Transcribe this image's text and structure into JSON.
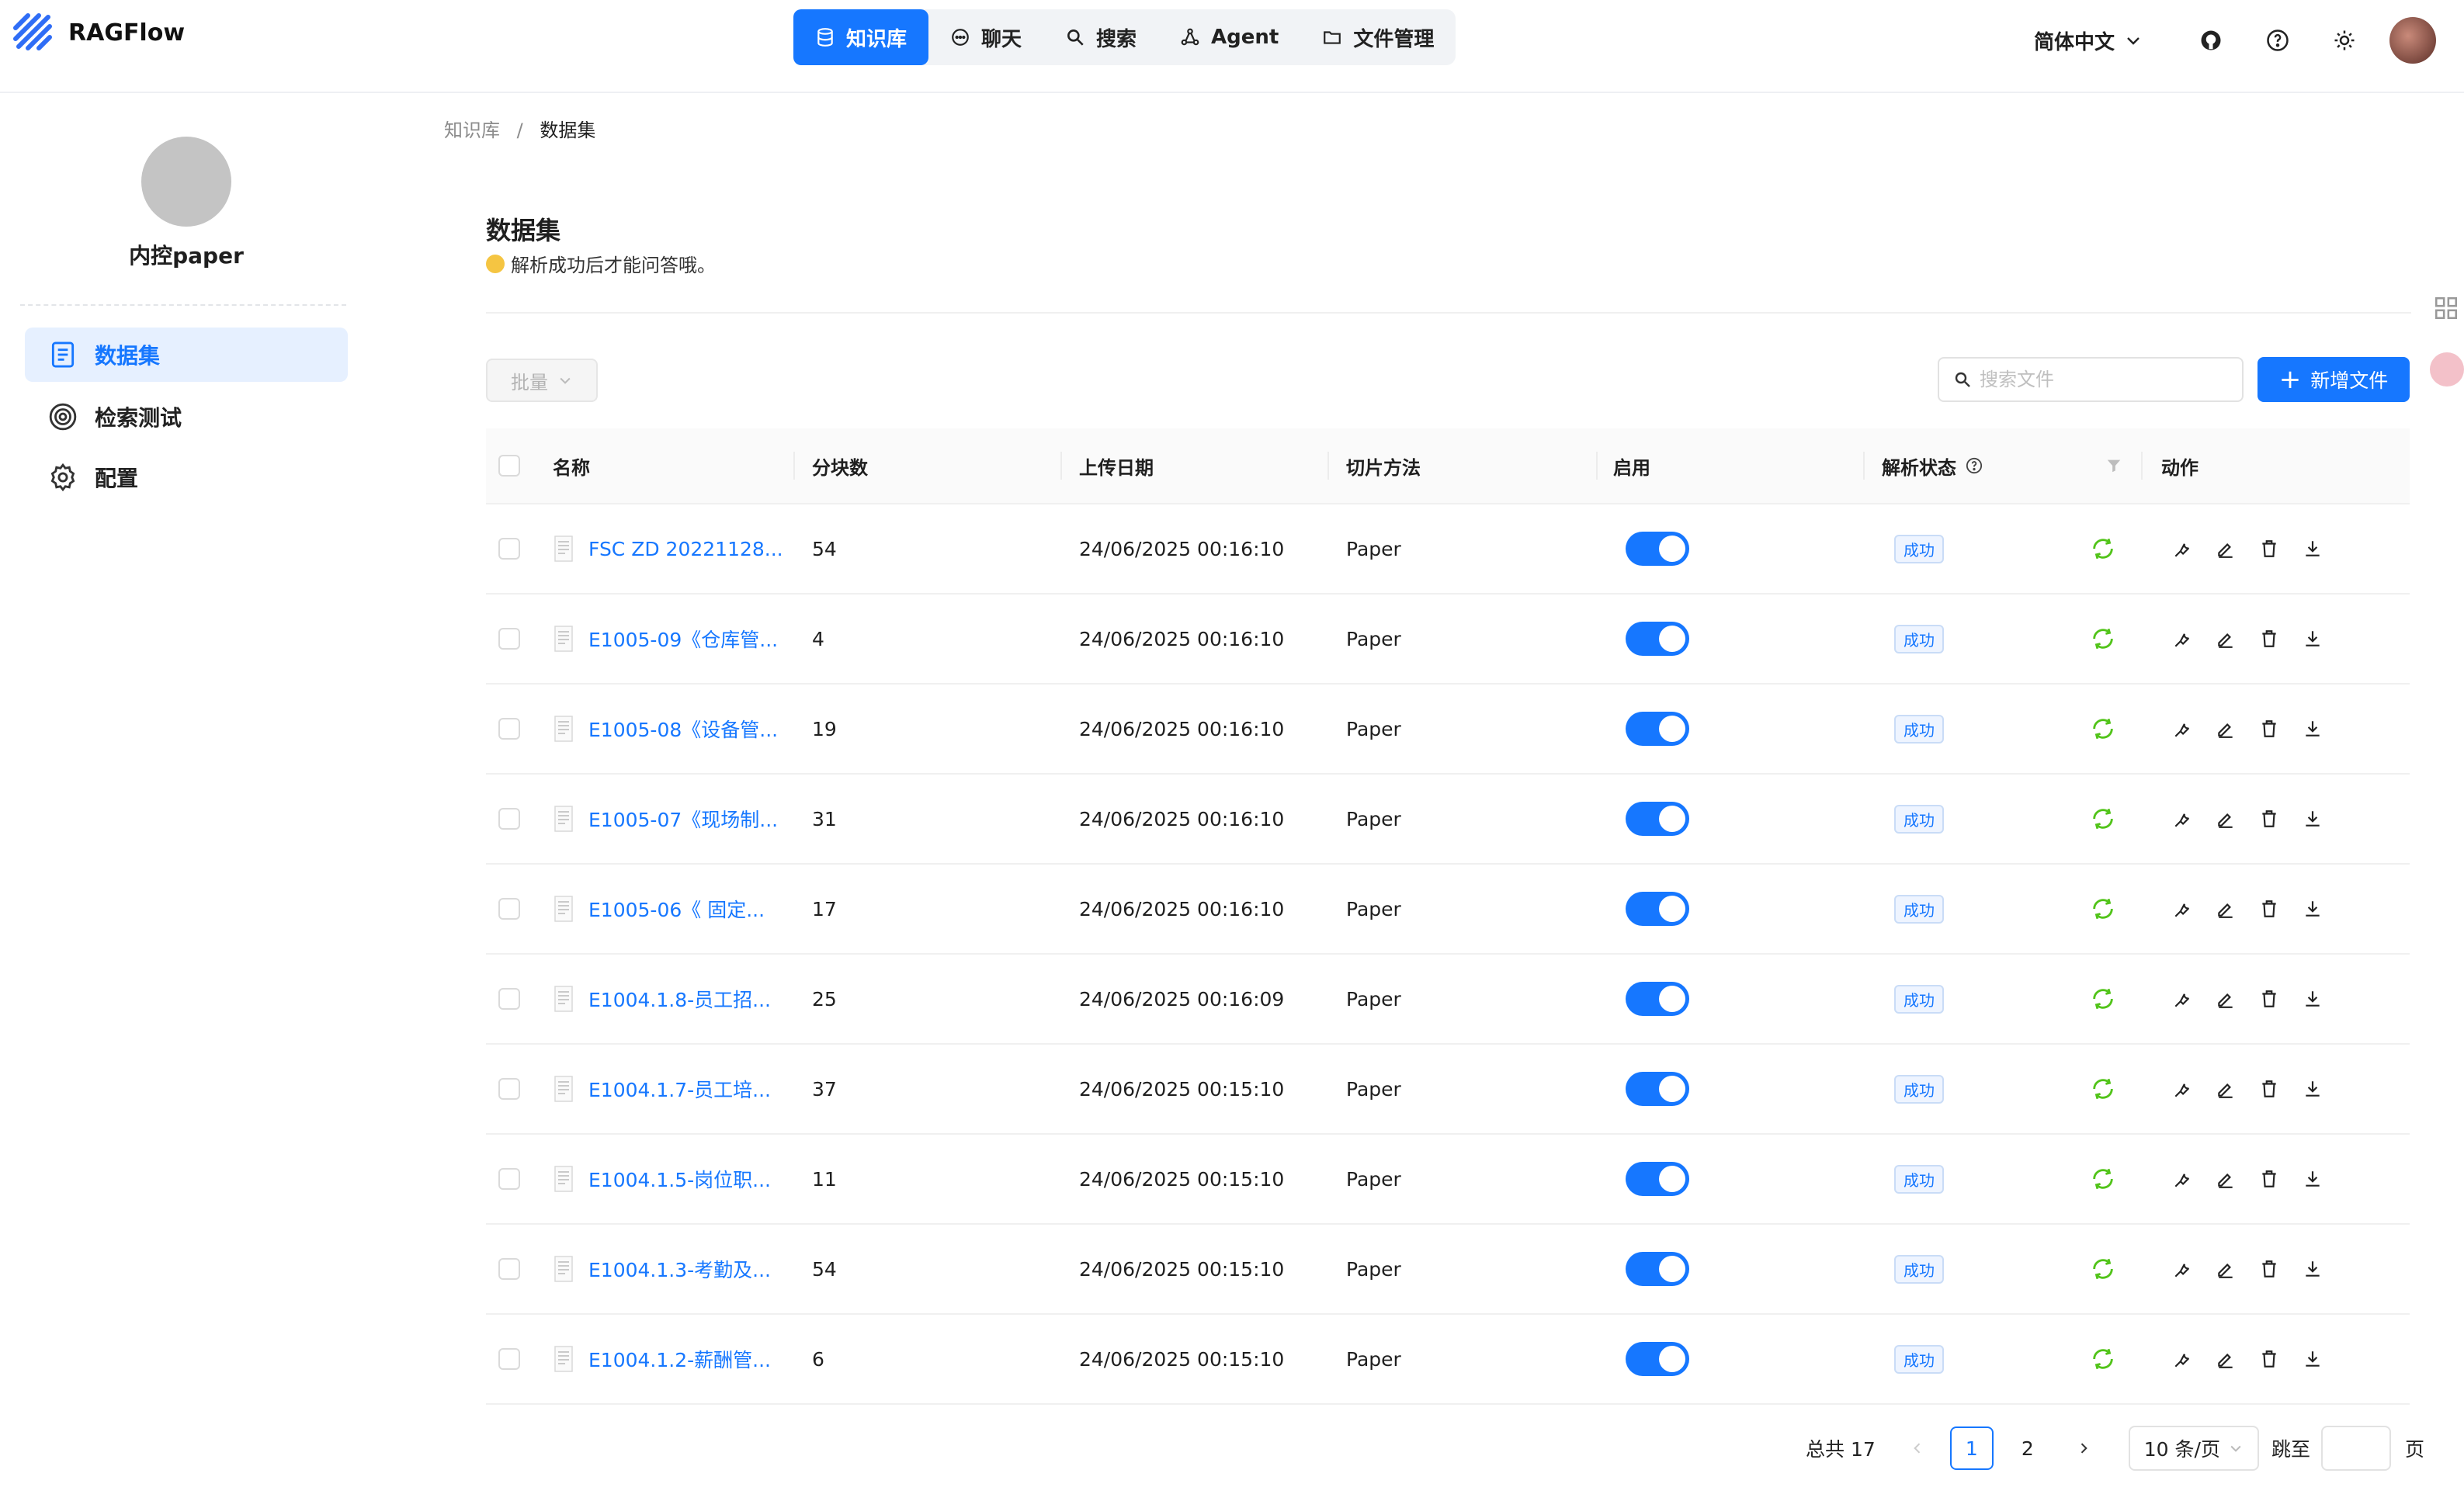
{
  "app": {
    "name": "RAGFlow"
  },
  "nav": [
    {
      "label": "知识库",
      "icon": "database-icon"
    },
    {
      "label": "聊天",
      "icon": "chat-icon"
    },
    {
      "label": "搜索",
      "icon": "search-icon"
    },
    {
      "label": "Agent",
      "icon": "agent-icon"
    },
    {
      "label": "文件管理",
      "icon": "folder-icon"
    }
  ],
  "header": {
    "language": "简体中文"
  },
  "sidebar": {
    "kb_name": "内控paper",
    "items": [
      {
        "label": "数据集",
        "icon": "dataset-icon",
        "active": true
      },
      {
        "label": "检索测试",
        "icon": "target-icon",
        "active": false
      },
      {
        "label": "配置",
        "icon": "gear-icon",
        "active": false
      }
    ]
  },
  "breadcrumb": {
    "parent": "知识库",
    "separator": "/",
    "current": "数据集"
  },
  "page": {
    "title": "数据集",
    "subtitle": "解析成功后才能问答哦。"
  },
  "toolbar": {
    "batch_label": "批量",
    "search_placeholder": "搜索文件",
    "add_label": "新增文件"
  },
  "table": {
    "columns": [
      "名称",
      "分块数",
      "上传日期",
      "切片方法",
      "启用",
      "解析状态",
      "动作"
    ],
    "rows": [
      {
        "name": "FSC ZD 20221128...",
        "chunks": "54",
        "date": "24/06/2025 00:16:10",
        "method": "Paper",
        "enabled": true,
        "status": "成功"
      },
      {
        "name": "E1005-09《仓库管...",
        "chunks": "4",
        "date": "24/06/2025 00:16:10",
        "method": "Paper",
        "enabled": true,
        "status": "成功"
      },
      {
        "name": "E1005-08《设备管...",
        "chunks": "19",
        "date": "24/06/2025 00:16:10",
        "method": "Paper",
        "enabled": true,
        "status": "成功"
      },
      {
        "name": "E1005-07《现场制...",
        "chunks": "31",
        "date": "24/06/2025 00:16:10",
        "method": "Paper",
        "enabled": true,
        "status": "成功"
      },
      {
        "name": "E1005-06《 固定...",
        "chunks": "17",
        "date": "24/06/2025 00:16:10",
        "method": "Paper",
        "enabled": true,
        "status": "成功"
      },
      {
        "name": "E1004.1.8-员工招...",
        "chunks": "25",
        "date": "24/06/2025 00:16:09",
        "method": "Paper",
        "enabled": true,
        "status": "成功"
      },
      {
        "name": "E1004.1.7-员工培...",
        "chunks": "37",
        "date": "24/06/2025 00:15:10",
        "method": "Paper",
        "enabled": true,
        "status": "成功"
      },
      {
        "name": "E1004.1.5-岗位职...",
        "chunks": "11",
        "date": "24/06/2025 00:15:10",
        "method": "Paper",
        "enabled": true,
        "status": "成功"
      },
      {
        "name": "E1004.1.3-考勤及...",
        "chunks": "54",
        "date": "24/06/2025 00:15:10",
        "method": "Paper",
        "enabled": true,
        "status": "成功"
      },
      {
        "name": "E1004.1.2-薪酬管...",
        "chunks": "6",
        "date": "24/06/2025 00:15:10",
        "method": "Paper",
        "enabled": true,
        "status": "成功"
      }
    ]
  },
  "pagination": {
    "total_label": "总共 17",
    "pages": [
      "1",
      "2"
    ],
    "current": "1",
    "page_size": "10 条/页",
    "jump_label": "跳至",
    "page_suffix": "页"
  },
  "colors": {
    "accent": "#1677ff",
    "success": "#52c41a"
  }
}
